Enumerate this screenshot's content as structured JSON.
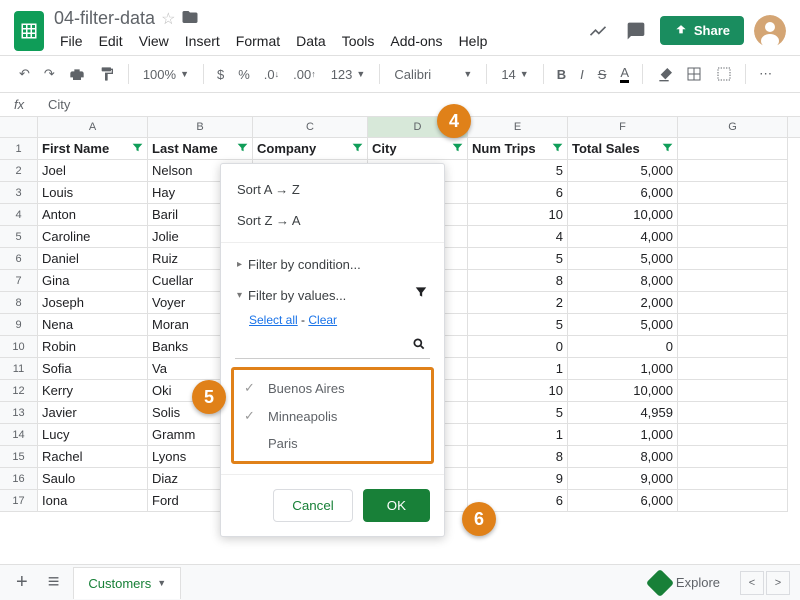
{
  "doc": {
    "title": "04-filter-data"
  },
  "menus": [
    "File",
    "Edit",
    "View",
    "Insert",
    "Format",
    "Data",
    "Tools",
    "Add-ons",
    "Help"
  ],
  "toolbar": {
    "zoom": "100%",
    "currency": "$",
    "percent": "%",
    "dec_dec": ".0",
    "dec_inc": ".00",
    "more_fmt": "123",
    "font": "Calibri",
    "size": "14"
  },
  "share_label": "Share",
  "formula": {
    "label": "fx",
    "value": "City"
  },
  "columns": [
    "A",
    "B",
    "C",
    "D",
    "E",
    "F",
    "G"
  ],
  "headers": [
    "First Name",
    "Last Name",
    "Company",
    "City",
    "Num Trips",
    "Total Sales"
  ],
  "rows": [
    {
      "n": "2",
      "first": "Joel",
      "last": "Nelson",
      "trips": "5",
      "sales": "5,000"
    },
    {
      "n": "3",
      "first": "Louis",
      "last": "Hay",
      "trips": "6",
      "sales": "6,000"
    },
    {
      "n": "4",
      "first": "Anton",
      "last": "Baril",
      "trips": "10",
      "sales": "10,000"
    },
    {
      "n": "5",
      "first": "Caroline",
      "last": "Jolie",
      "trips": "4",
      "sales": "4,000"
    },
    {
      "n": "6",
      "first": "Daniel",
      "last": "Ruiz",
      "trips": "5",
      "sales": "5,000"
    },
    {
      "n": "7",
      "first": "Gina",
      "last": "Cuellar",
      "trips": "8",
      "sales": "8,000"
    },
    {
      "n": "8",
      "first": "Joseph",
      "last": "Voyer",
      "trips": "2",
      "sales": "2,000"
    },
    {
      "n": "9",
      "first": "Nena",
      "last": "Moran",
      "trips": "5",
      "sales": "5,000"
    },
    {
      "n": "10",
      "first": "Robin",
      "last": "Banks",
      "trips": "0",
      "sales": "0"
    },
    {
      "n": "11",
      "first": "Sofia",
      "last": "Va",
      "trips": "1",
      "sales": "1,000"
    },
    {
      "n": "12",
      "first": "Kerry",
      "last": "Oki",
      "trips": "10",
      "sales": "10,000"
    },
    {
      "n": "13",
      "first": "Javier",
      "last": "Solis",
      "trips": "5",
      "sales": "4,959"
    },
    {
      "n": "14",
      "first": "Lucy",
      "last": "Gramm",
      "trips": "1",
      "sales": "1,000"
    },
    {
      "n": "15",
      "first": "Rachel",
      "last": "Lyons",
      "trips": "8",
      "sales": "8,000"
    },
    {
      "n": "16",
      "first": "Saulo",
      "last": "Diaz",
      "trips": "9",
      "sales": "9,000"
    },
    {
      "n": "17",
      "first": "Iona",
      "last": "Ford",
      "trips": "6",
      "sales": "6,000"
    }
  ],
  "filter": {
    "sort_az": "Sort A → Z",
    "sort_za": "Sort Z → A",
    "by_condition": "Filter by condition...",
    "by_values": "Filter by values...",
    "select_all": "Select all",
    "clear": "Clear",
    "dash": " - ",
    "values": [
      {
        "label": "Buenos Aires",
        "checked": true
      },
      {
        "label": "Minneapolis",
        "checked": true
      },
      {
        "label": "Paris",
        "checked": false
      }
    ],
    "cancel": "Cancel",
    "ok": "OK"
  },
  "callouts": {
    "c4": "4",
    "c5": "5",
    "c6": "6"
  },
  "sheet": {
    "name": "Customers",
    "explore": "Explore"
  }
}
